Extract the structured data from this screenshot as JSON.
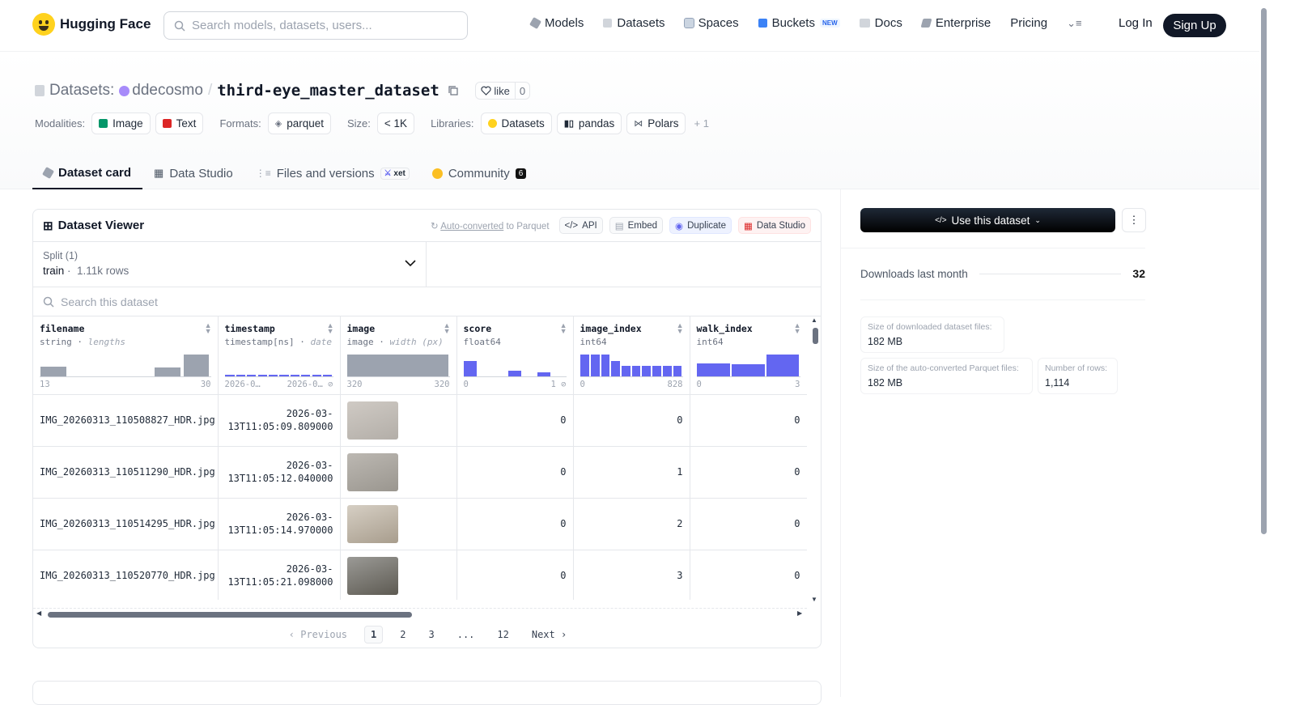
{
  "nav": {
    "brand": "Hugging Face",
    "search_placeholder": "Search models, datasets, users...",
    "items": [
      "Models",
      "Datasets",
      "Spaces",
      "Buckets",
      "Docs",
      "Enterprise",
      "Pricing"
    ],
    "buckets_badge": "NEW",
    "login": "Log In",
    "signup": "Sign Up"
  },
  "header": {
    "section": "Datasets:",
    "owner": "ddecosmo",
    "separator": "/",
    "name": "third-eye_master_dataset",
    "like_label": "like",
    "like_count": "0",
    "modalities_label": "Modalities:",
    "modalities": [
      "Image",
      "Text"
    ],
    "formats_label": "Formats:",
    "formats": [
      "parquet"
    ],
    "size_label": "Size:",
    "size": "< 1K",
    "libraries_label": "Libraries:",
    "libraries": [
      "Datasets",
      "pandas",
      "Polars"
    ],
    "libraries_more": "+ 1"
  },
  "tabs": {
    "card": "Dataset card",
    "studio": "Data Studio",
    "files": "Files and versions",
    "xet": "xet",
    "community": "Community",
    "community_count": "6"
  },
  "viewer": {
    "title": "Dataset Viewer",
    "auto_converted": "Auto-converted",
    "to_parquet": " to Parquet",
    "api": "API",
    "embed": "Embed",
    "duplicate": "Duplicate",
    "data_studio": "Data Studio",
    "split_label": "Split (1)",
    "split_value": "train",
    "split_rows": "1.11k rows",
    "search_placeholder": "Search this dataset",
    "columns": [
      {
        "name": "filename",
        "type": "string",
        "sub": "lengths",
        "min": "13",
        "max": "30",
        "bars": [
          0.45,
          0,
          0,
          0,
          0.4,
          1.0
        ],
        "bar_color": "#9ca3af"
      },
      {
        "name": "timestamp",
        "type": "timestamp[ns]",
        "sub": "date",
        "min": "2026-0…",
        "max": "2026-0…",
        "null": "⊘",
        "bars": [
          0.06,
          0.06,
          0.06,
          0.06,
          0.06,
          0.06,
          0.06,
          0.06,
          0.06,
          0.06
        ],
        "bar_color": "#6366f1"
      },
      {
        "name": "image",
        "type": "image",
        "sub": "width (px)",
        "min": "320",
        "max": "320",
        "bars": [
          1.0
        ],
        "bar_color": "#9ca3af"
      },
      {
        "name": "score",
        "type": "float64",
        "sub": "",
        "min": "0",
        "max": "1",
        "null": "⊘",
        "bars": [
          0.7,
          0,
          0,
          0.25,
          0,
          0.2,
          0
        ],
        "bar_color": "#6366f1"
      },
      {
        "name": "image_index",
        "type": "int64",
        "sub": "",
        "min": "0",
        "max": "828",
        "bars": [
          1.0,
          1.0,
          1.0,
          0.7,
          0.5,
          0.5,
          0.5,
          0.5,
          0.5,
          0.5
        ],
        "bar_color": "#6366f1"
      },
      {
        "name": "walk_index",
        "type": "int64",
        "sub": "",
        "min": "0",
        "max": "3",
        "bars": [
          0.6,
          0.55,
          1.0
        ],
        "bar_color": "#6366f1"
      }
    ],
    "rows": [
      {
        "filename": "IMG_20260313_110508827_HDR.jpg",
        "ts1": "2026-03-",
        "ts2": "13T11:05:09.809000",
        "score": "0",
        "image_index": "0",
        "walk_index": "0",
        "img": [
          "#cfcac4",
          "#b3aea8"
        ]
      },
      {
        "filename": "IMG_20260313_110511290_HDR.jpg",
        "ts1": "2026-03-",
        "ts2": "13T11:05:12.040000",
        "score": "0",
        "image_index": "1",
        "walk_index": "0",
        "img": [
          "#bcb8b2",
          "#9a968f"
        ]
      },
      {
        "filename": "IMG_20260313_110514295_HDR.jpg",
        "ts1": "2026-03-",
        "ts2": "13T11:05:14.970000",
        "score": "0",
        "image_index": "2",
        "walk_index": "0",
        "img": [
          "#d6cfc4",
          "#a89d8d"
        ]
      },
      {
        "filename": "IMG_20260313_110520770_HDR.jpg",
        "ts1": "2026-03-",
        "ts2": "13T11:05:21.098000",
        "score": "0",
        "image_index": "3",
        "walk_index": "0",
        "img": [
          "#9b9a96",
          "#5d5a52"
        ]
      },
      {
        "filename": "",
        "ts1": "",
        "ts2": "",
        "score": "",
        "image_index": "",
        "walk_index": "",
        "img": [
          "#c8c4be",
          "#8c8880"
        ]
      }
    ],
    "pager": {
      "prev": "Previous",
      "pages": [
        "1",
        "2",
        "3",
        "...",
        "12"
      ],
      "next": "Next"
    }
  },
  "sidebar": {
    "use_button": "Use this dataset",
    "downloads_label": "Downloads last month",
    "downloads": "32",
    "stats": [
      {
        "label": "Size of downloaded dataset files:",
        "value": "182 MB"
      },
      {
        "label": "Size of the auto-converted Parquet files:",
        "value": "182 MB"
      },
      {
        "label": "Number of rows:",
        "value": "1,114"
      }
    ]
  }
}
